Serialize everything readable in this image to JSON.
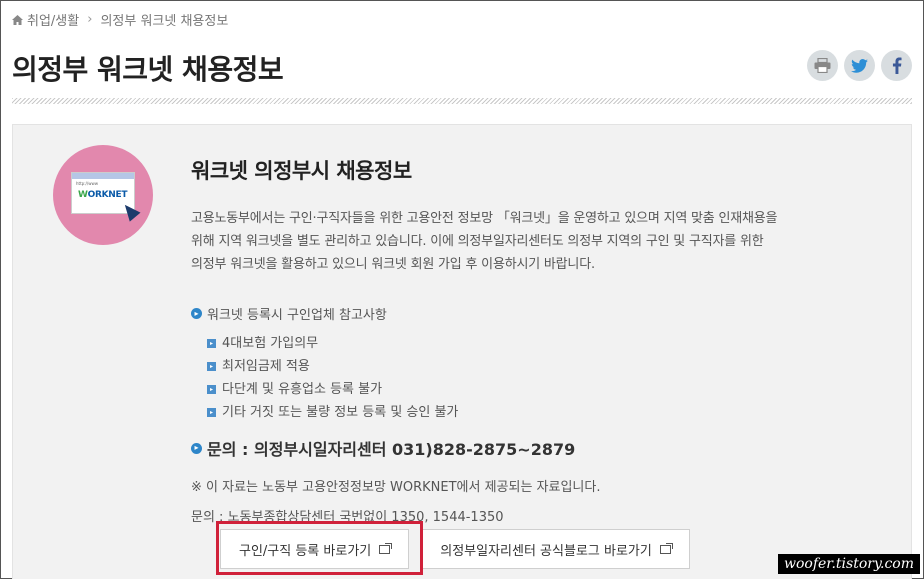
{
  "breadcrumb": {
    "home": "취업/생활",
    "current": "의정부 워크넷 채용정보"
  },
  "page_title": "의정부 워크넷 채용정보",
  "share": {
    "print_icon": "print-icon",
    "twitter_icon": "twitter-icon",
    "facebook_icon": "facebook-icon"
  },
  "logo": {
    "addr": "http://www",
    "brand_main": "ORKNET",
    "brand_w": "W"
  },
  "content": {
    "heading": "워크넷 의정부시 채용정보",
    "desc_line1": "고용노동부에서는 구인·구직자들을 위한 고용안전 정보망 「워크넷」을 운영하고 있으며 지역 맞춤 인재채용을",
    "desc_line2": "위해 지역 워크넷을 별도 관리하고 있습니다. 이에 의정부일자리센터도 의정부 지역의 구인 및 구직자를 위한",
    "desc_line3": "의정부 워크넷을 활용하고 있으니 워크넷 회원 가입 후 이용하시기 바랍니다.",
    "bullet_head": "워크넷 등록시 구인업체 참고사항",
    "items": [
      "4대보험 가입의무",
      "최저임금제 적용",
      "다단계 및 유흥업소 등록 불가",
      "기타 거짓 또는 불량 정보 등록 및 승인 불가"
    ],
    "contact": "문의 : 의정부시일자리센터 031)828-2875~2879",
    "note": "※ 이 자료는 노동부 고용안정정보망 WORKNET에서 제공되는 자료입니다.",
    "note2": "문의 : 노동부종합상담센터 국번없이 1350, 1544-1350"
  },
  "buttons": {
    "register": "구인/구직 등록 바로가기",
    "blog": "의정부일자리센터 공식블로그 바로가기"
  },
  "watermark": "woofer.tistory.com",
  "colors": {
    "accent": "#2e86c9",
    "highlight": "#d0213a",
    "logo_bg": "#e288ad"
  }
}
